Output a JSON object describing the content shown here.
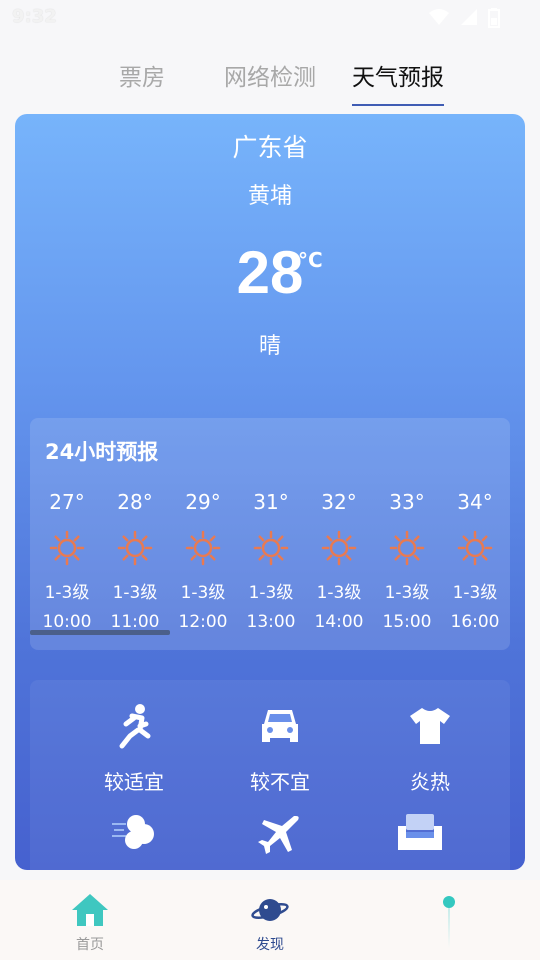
{
  "status": {
    "time": "9:32"
  },
  "tabs": [
    {
      "label": "票房"
    },
    {
      "label": "网络检测"
    },
    {
      "label": "天气预报"
    }
  ],
  "weather": {
    "province": "广东省",
    "district": "黄埔",
    "temp": "28",
    "unit": "°C",
    "condition": "晴"
  },
  "forecast": {
    "title": "24小时预报",
    "hours": [
      {
        "temp": "27°",
        "wind": "1-3级",
        "time": "10:00",
        "icon": "sun-icon"
      },
      {
        "temp": "28°",
        "wind": "1-3级",
        "time": "11:00",
        "icon": "sun-icon"
      },
      {
        "temp": "29°",
        "wind": "1-3级",
        "time": "12:00",
        "icon": "sun-icon"
      },
      {
        "temp": "31°",
        "wind": "1-3级",
        "time": "13:00",
        "icon": "sun-icon"
      },
      {
        "temp": "32°",
        "wind": "1-3级",
        "time": "14:00",
        "icon": "sun-icon"
      },
      {
        "temp": "33°",
        "wind": "1-3级",
        "time": "15:00",
        "icon": "sun-icon"
      },
      {
        "temp": "34°",
        "wind": "1-3级",
        "time": "16:00",
        "icon": "sun-icon"
      }
    ]
  },
  "life": [
    {
      "label": "较适宜",
      "icon": "running-icon"
    },
    {
      "label": "较不宜",
      "icon": "car-icon"
    },
    {
      "label": "炎热",
      "icon": "tshirt-icon"
    },
    {
      "label": "",
      "icon": "wind-cloud-icon"
    },
    {
      "label": "",
      "icon": "airplane-icon"
    },
    {
      "label": "",
      "icon": "sofa-icon"
    }
  ],
  "nav": {
    "home": "首页",
    "discover": "发现"
  },
  "colors": {
    "accent": "#3f5cb4",
    "sun": "#e87a52",
    "home_icon": "#3fc7c0"
  }
}
